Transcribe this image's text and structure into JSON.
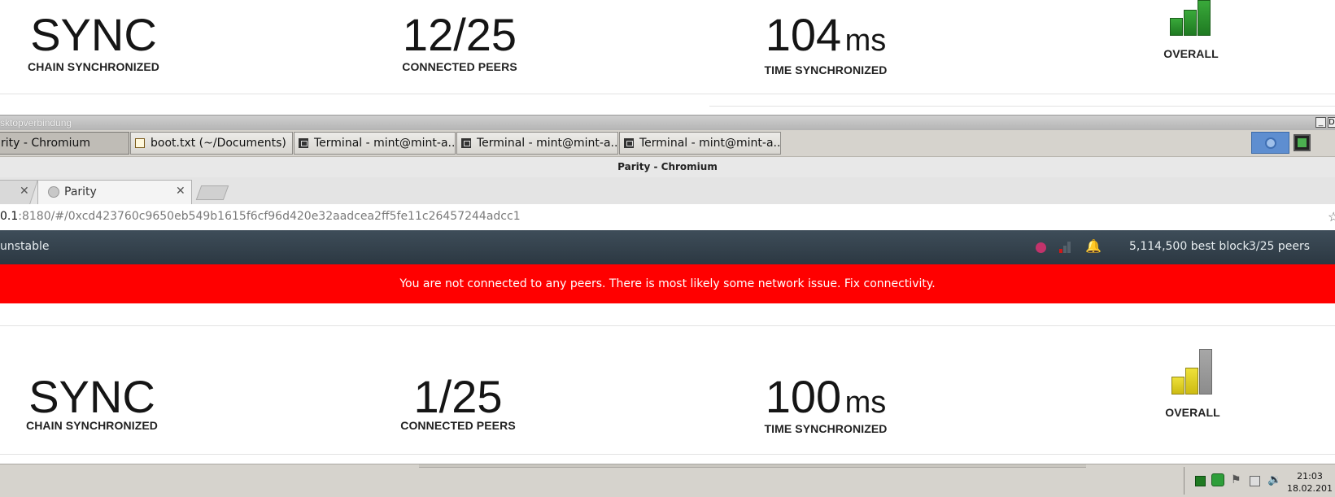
{
  "top_stats": {
    "sync_value": "SYNC",
    "sync_label": "CHAIN SYNCHRONIZED",
    "peers_value": "12/25",
    "peers_label": "CONNECTED PEERS",
    "time_value": "104",
    "time_unit": "ms",
    "time_label": "TIME SYNCHRONIZED",
    "overall_label": "OVERALL",
    "overall_signal": {
      "level": "good",
      "color": "#2a8f2c"
    }
  },
  "rdp_window": {
    "title": "sktopverbindung",
    "min_button": "_",
    "max_button": "D"
  },
  "taskbar": {
    "tasks": [
      {
        "label": "rity - Chromium",
        "icon": "chromium-icon"
      },
      {
        "label": "boot.txt (~/Documents)",
        "icon": "text-editor-icon"
      },
      {
        "label": "Terminal - mint@mint-a...",
        "icon": "terminal-icon"
      },
      {
        "label": "Terminal - mint@mint-a...",
        "icon": "terminal-icon"
      },
      {
        "label": "Terminal - mint@mint-a...",
        "icon": "terminal-icon"
      }
    ]
  },
  "browser": {
    "window_title": "Parity - Chromium",
    "tabs": [
      {
        "label": ""
      },
      {
        "label": "Parity"
      }
    ],
    "url_host": "0.1",
    "url_rest": ":8180/#/0xcd423760c9650eb549b1615f6cf96d420e32aadcea2ff5fe11c26457244adcc1"
  },
  "parity_bar": {
    "channel": "unstable",
    "best_block": "5,114,500 best block",
    "peers": "3/25 peers",
    "status_dot_color": "#c2336b"
  },
  "alert": {
    "message": "You are not connected to any peers. There is most likely some network issue. Fix connectivity.",
    "color": "#ff0000"
  },
  "bottom_stats": {
    "sync_value": "SYNC",
    "sync_label": "CHAIN SYNCHRONIZED",
    "peers_value": "1/25",
    "peers_label": "CONNECTED PEERS",
    "time_value": "100",
    "time_unit": "ms",
    "time_label": "TIME SYNCHRONIZED",
    "overall_label": "OVERALL",
    "overall_signal": {
      "level": "warning",
      "color": "#e0d020"
    }
  },
  "system_tray": {
    "time": "21:03",
    "date": "18.02.201"
  }
}
